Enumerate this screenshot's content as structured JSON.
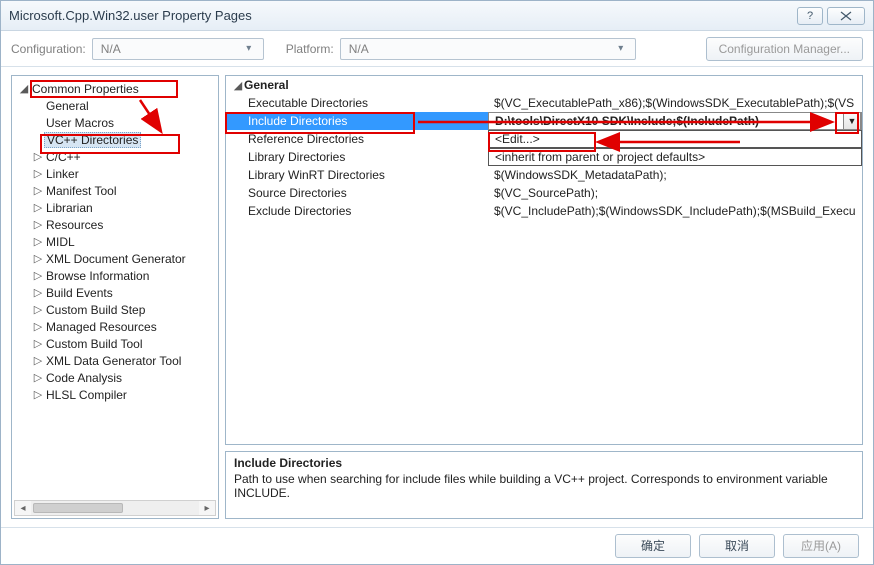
{
  "title": "Microsoft.Cpp.Win32.user Property Pages",
  "config": {
    "configuration_label": "Configuration:",
    "configuration_value": "N/A",
    "platform_label": "Platform:",
    "platform_value": "N/A",
    "config_manager_label": "Configuration Manager..."
  },
  "tree": {
    "root": "Common Properties",
    "items": [
      "General",
      "User Macros",
      "VC++ Directories",
      "C/C++",
      "Linker",
      "Manifest Tool",
      "Librarian",
      "Resources",
      "MIDL",
      "XML Document Generator",
      "Browse Information",
      "Build Events",
      "Custom Build Step",
      "Managed Resources",
      "Custom Build Tool",
      "XML Data Generator Tool",
      "Code Analysis",
      "HLSL Compiler"
    ],
    "selected": "VC++ Directories"
  },
  "grid": {
    "group": "General",
    "rows": [
      {
        "name": "Executable Directories",
        "value": "$(VC_ExecutablePath_x86);$(WindowsSDK_ExecutablePath);$(VS"
      },
      {
        "name": "Include Directories",
        "value": "D:\\tools\\DirectX10 SDK\\Include;$(IncludePath)",
        "selected": true
      },
      {
        "name": "Reference Directories",
        "value": "<Edit...>",
        "edit": true
      },
      {
        "name": "Library Directories",
        "value": "<inherit from parent or project defaults>",
        "edit": true
      },
      {
        "name": "Library WinRT Directories",
        "value": "$(WindowsSDK_MetadataPath);"
      },
      {
        "name": "Source Directories",
        "value": "$(VC_SourcePath);"
      },
      {
        "name": "Exclude Directories",
        "value": "$(VC_IncludePath);$(WindowsSDK_IncludePath);$(MSBuild_Execu"
      }
    ]
  },
  "description": {
    "title": "Include Directories",
    "text": "Path to use when searching for include files while building a VC++ project.  Corresponds to environment variable INCLUDE."
  },
  "footer": {
    "ok": "确定",
    "cancel": "取消",
    "apply": "应用(A)"
  }
}
